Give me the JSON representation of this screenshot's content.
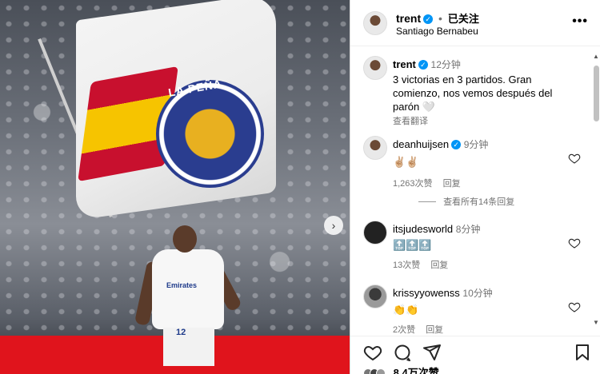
{
  "post": {
    "author": "trent",
    "follow_status": "已关注",
    "location": "Santiago Bernabeu",
    "more": "•••",
    "image_text": {
      "flag_crest": "LA PEÑA",
      "sponsor": "Emirates",
      "shirt_number": "12"
    },
    "caption": {
      "username": "trent",
      "time": "12分钟",
      "text": "3 victorias en 3 partidos. Gran comienzo, nos vemos después del parón 🤍",
      "translate": "查看翻译"
    },
    "likes_text": "8.4万次赞"
  },
  "comments": [
    {
      "username": "deanhuijsen",
      "verified": true,
      "time": "9分钟",
      "text": "✌🏼✌🏼",
      "likes": "1,263次赞",
      "reply": "回复",
      "view_replies": "查看所有14条回复"
    },
    {
      "username": "itsjudesworld",
      "verified": false,
      "time": "8分钟",
      "text": "🔝🔝🔝",
      "likes": "13次赞",
      "reply": "回复"
    },
    {
      "username": "krissyyowenss",
      "verified": false,
      "time": "10分钟",
      "text": "👏👏",
      "likes": "2次赞",
      "reply": "回复"
    }
  ],
  "icons": {
    "verified": "verified-badge-icon",
    "heart": "heart-icon",
    "comment": "comment-icon",
    "share": "share-icon",
    "save": "bookmark-icon",
    "next": "chevron-right-icon"
  },
  "colors": {
    "verified_blue": "#0095f6",
    "muted_text": "#737373",
    "pitch_red": "#e0141c"
  }
}
